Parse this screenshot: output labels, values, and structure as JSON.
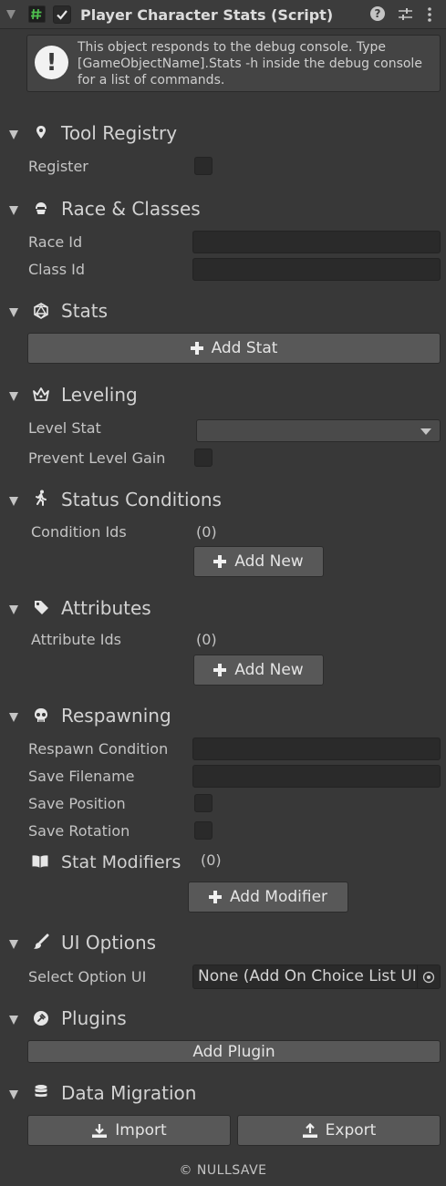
{
  "header": {
    "title": "Player Character Stats (Script)",
    "enabled": true,
    "help_glyph": "?",
    "presets_icon": "sliders-icon",
    "menu_icon": "kebab-menu-icon"
  },
  "help_box": {
    "text": "This object responds to the debug console. Type [GameObjectName].Stats -h inside the debug console for a list of commands."
  },
  "sections": {
    "tool_registry": {
      "title": "Tool Registry",
      "register_label": "Register"
    },
    "race_classes": {
      "title": "Race & Classes",
      "race_label": "Race Id",
      "race_value": "",
      "class_label": "Class Id",
      "class_value": ""
    },
    "stats": {
      "title": "Stats",
      "add_label": "Add Stat"
    },
    "leveling": {
      "title": "Leveling",
      "level_stat_label": "Level Stat",
      "level_stat_value": "",
      "prevent_label": "Prevent Level Gain"
    },
    "status_conditions": {
      "title": "Status Conditions",
      "list_label": "Condition Ids",
      "count": "(0)",
      "add_label": "Add New"
    },
    "attributes": {
      "title": "Attributes",
      "list_label": "Attribute Ids",
      "count": "(0)",
      "add_label": "Add New"
    },
    "respawning": {
      "title": "Respawning",
      "respawn_label": "Respawn Condition",
      "respawn_value": "",
      "filename_label": "Save Filename",
      "filename_value": "",
      "position_label": "Save Position",
      "rotation_label": "Save Rotation",
      "modifiers_label": "Stat Modifiers",
      "modifiers_count": "(0)",
      "add_modifier_label": "Add Modifier"
    },
    "ui_options": {
      "title": "UI Options",
      "select_label": "Select Option UI",
      "select_value": "None (Add On Choice List UI)"
    },
    "plugins": {
      "title": "Plugins",
      "add_label": "Add Plugin"
    },
    "data_migration": {
      "title": "Data Migration",
      "import_label": "Import",
      "export_label": "Export"
    }
  },
  "footer": {
    "text": "© NULLSAVE"
  }
}
